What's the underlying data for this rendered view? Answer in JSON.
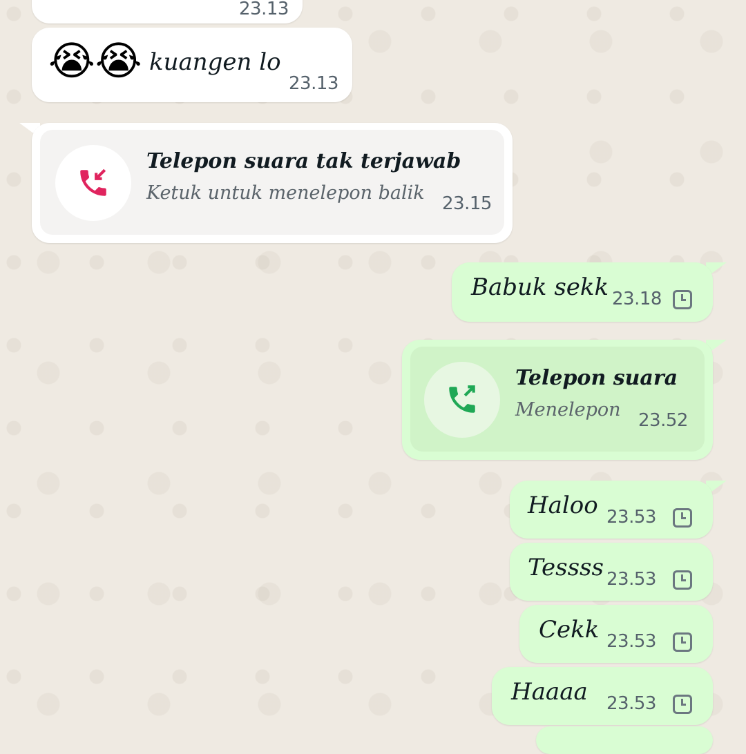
{
  "colors": {
    "incoming": "#ffffff",
    "outgoing": "#d9fdd3",
    "missed_call_icon": "#e0245e",
    "outgoing_call_icon": "#1fa855",
    "wallpaper": "#efeae2"
  },
  "messages": {
    "m0": {
      "time": "23.13"
    },
    "m1": {
      "emoji": "😭😭",
      "text": "kuangen lo",
      "time": "23.13"
    },
    "m2": {
      "title": "Telepon suara tak terjawab",
      "subtitle": "Ketuk untuk menelepon balik",
      "time": "23.15",
      "icon": "missed-call-icon"
    },
    "m3": {
      "text": "Babuk sekk",
      "time": "23.18",
      "status_icon": "pending-clock-icon"
    },
    "m4": {
      "title": "Telepon suara",
      "subtitle": "Menelepon",
      "time": "23.52",
      "icon": "outgoing-call-icon"
    },
    "m5": {
      "text": "Haloo",
      "time": "23.53",
      "status_icon": "pending-clock-icon"
    },
    "m6": {
      "text": "Tessss",
      "time": "23.53",
      "status_icon": "pending-clock-icon"
    },
    "m7": {
      "text": "Cekk",
      "time": "23.53",
      "status_icon": "pending-clock-icon"
    },
    "m8": {
      "text": "Haaaa",
      "time": "23.53",
      "status_icon": "pending-clock-icon"
    }
  }
}
